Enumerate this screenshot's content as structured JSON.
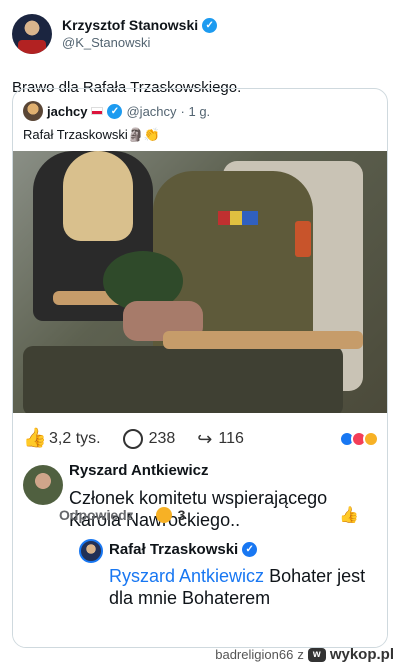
{
  "tweet": {
    "author_name": "Krzysztof Stanowski",
    "handle": "@K_Stanowski",
    "text": "Brawo dla Rafała Trzaskowskiego."
  },
  "quote": {
    "author_name": "jachcy",
    "handle": "@jachcy",
    "time": "· 1 g.",
    "text": "Rafał Trzaskowski🗿👏"
  },
  "facebook": {
    "likes": "3,2 tys.",
    "comments": "238",
    "shares": "116",
    "comment": {
      "author": "Ryszard Antkiewicz",
      "text": "Członek komitetu wspierającego Karola Nawrockiego..",
      "reply_label": "Odpowiedz",
      "reaction_count": "3"
    },
    "reply": {
      "author": "Rafał Trzaskowski",
      "mention": "Ryszard Antkiewicz",
      "text": " Bohater jest dla mnie Bohaterem"
    }
  },
  "footer": {
    "uploader": "badreligion66",
    "sep": "z",
    "site": "wykop.pl"
  },
  "icons": {
    "verified": "verified-icon",
    "like": "thumb-up-icon",
    "comment": "comment-icon",
    "share": "share-icon"
  },
  "colors": {
    "accent": "#1d9bf0",
    "fb_blue": "#1877f2"
  }
}
